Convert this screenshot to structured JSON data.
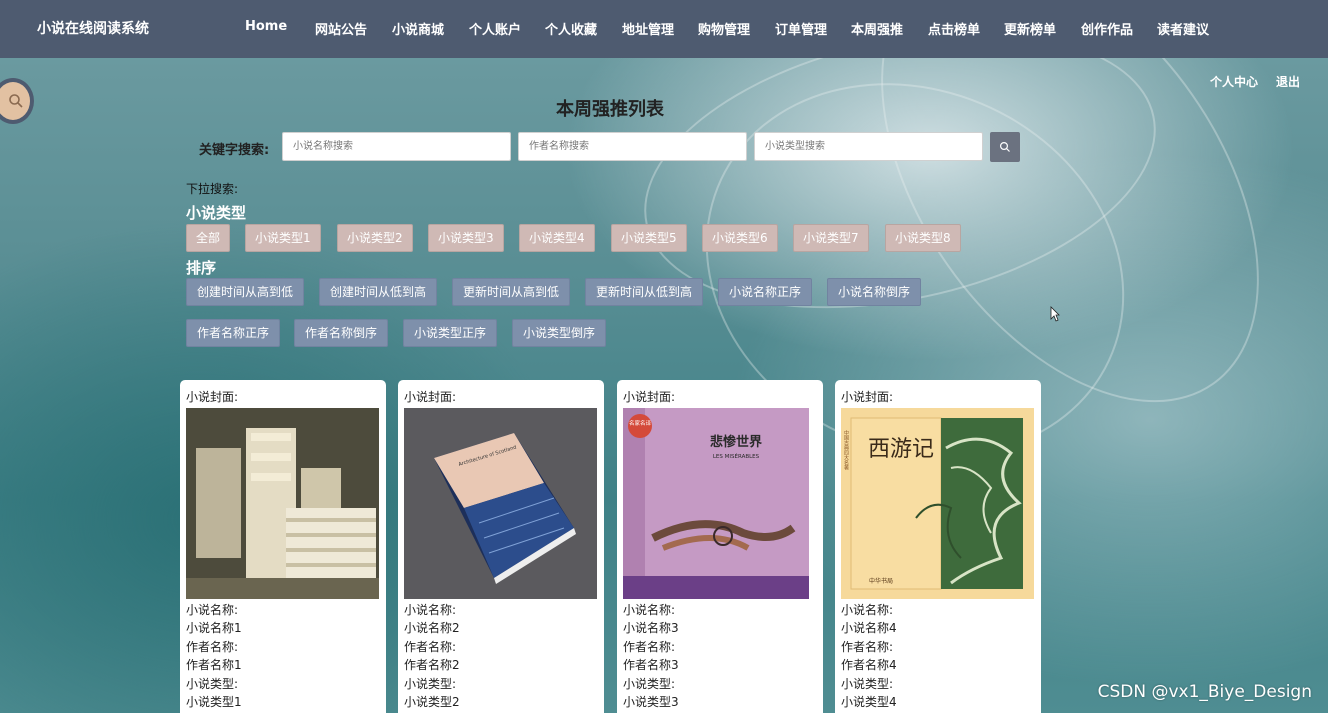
{
  "brand": "小说在线阅读系统",
  "nav": [
    "Home",
    "网站公告",
    "小说商城",
    "个人账户",
    "个人收藏",
    "地址管理",
    "购物管理",
    "订单管理",
    "本周强推",
    "点击榜单",
    "更新榜单",
    "创作作品",
    "读者建议"
  ],
  "user_links": {
    "center": "个人中心",
    "logout": "退出"
  },
  "page_title": "本周强推列表",
  "search": {
    "label": "关键字搜索:",
    "name_placeholder": "小说名称搜索",
    "author_placeholder": "作者名称搜索",
    "type_placeholder": "小说类型搜索"
  },
  "dropdown_label": "下拉搜索:",
  "type_section": "小说类型",
  "types": [
    "全部",
    "小说类型1",
    "小说类型2",
    "小说类型3",
    "小说类型4",
    "小说类型5",
    "小说类型6",
    "小说类型7",
    "小说类型8"
  ],
  "sort_section": "排序",
  "sorts_row1": [
    "创建时间从高到低",
    "创建时间从低到高",
    "更新时间从高到低",
    "更新时间从低到高",
    "小说名称正序",
    "小说名称倒序"
  ],
  "sorts_row2": [
    "作者名称正序",
    "作者名称倒序",
    "小说类型正序",
    "小说类型倒序"
  ],
  "card_labels": {
    "cover": "小说封面:",
    "name": "小说名称:",
    "author": "作者名称:",
    "type": "小说类型:"
  },
  "cards": [
    {
      "name": "小说名称1",
      "author": "作者名称1",
      "type": "小说类型1",
      "cover_icon": "book-stack-photo"
    },
    {
      "name": "小说名称2",
      "author": "作者名称2",
      "type": "小说类型2",
      "cover_icon": "architecture-book-photo",
      "cover_title": "Architecture of Scotland"
    },
    {
      "name": "小说名称3",
      "author": "作者名称3",
      "type": "小说类型3",
      "cover_icon": "les-miserables-book",
      "cover_title": "悲惨世界",
      "cover_subtitle": "LES MISÉRABLES",
      "cover_badge": "名家名译"
    },
    {
      "name": "小说名称4",
      "author": "作者名称4",
      "type": "小说类型4",
      "cover_icon": "journey-to-west-book",
      "cover_title": "西游记",
      "cover_side": "中国古典四大名著",
      "cover_publisher": "中华书局"
    }
  ],
  "watermark": "CSDN @vx1_Biye_Design",
  "colors": {
    "nav_bg": "#4e5b70",
    "type_btn": "#cfb9b5",
    "sort_btn": "#7e90ab",
    "search_btn": "#6b7280",
    "float_search": "#e2c1a2"
  }
}
